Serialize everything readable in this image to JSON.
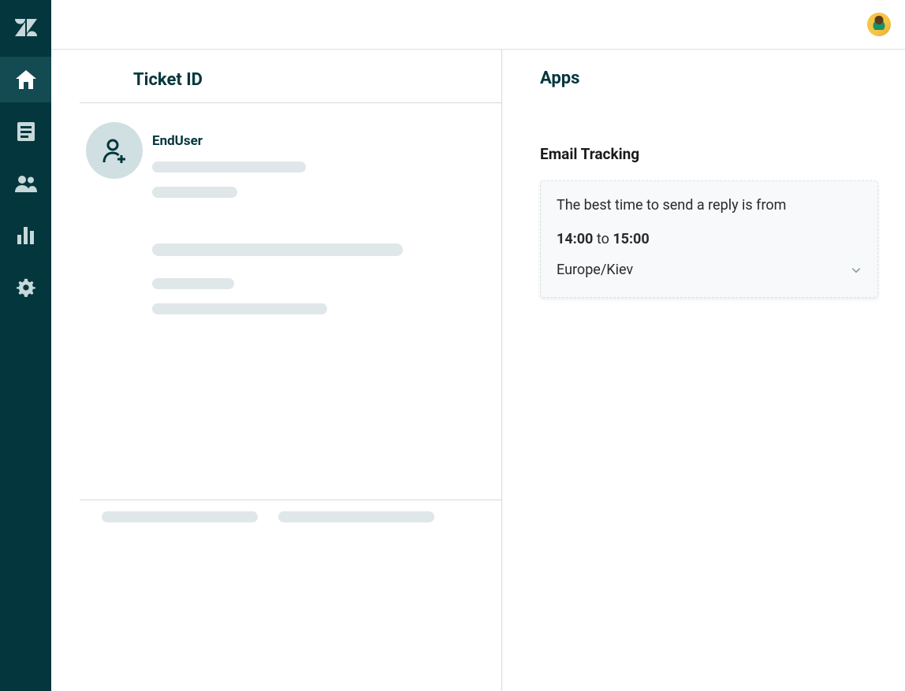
{
  "ticket": {
    "header_label": "Ticket  ID",
    "user_name": "EndUser"
  },
  "apps": {
    "panel_title": "Apps",
    "email_tracking": {
      "name": "Email Tracking",
      "lead_text": "The best time to send a reply is from",
      "time_from": "14:00",
      "time_joiner": "to",
      "time_to": "15:00",
      "timezone": "Europe/Kiev"
    }
  }
}
